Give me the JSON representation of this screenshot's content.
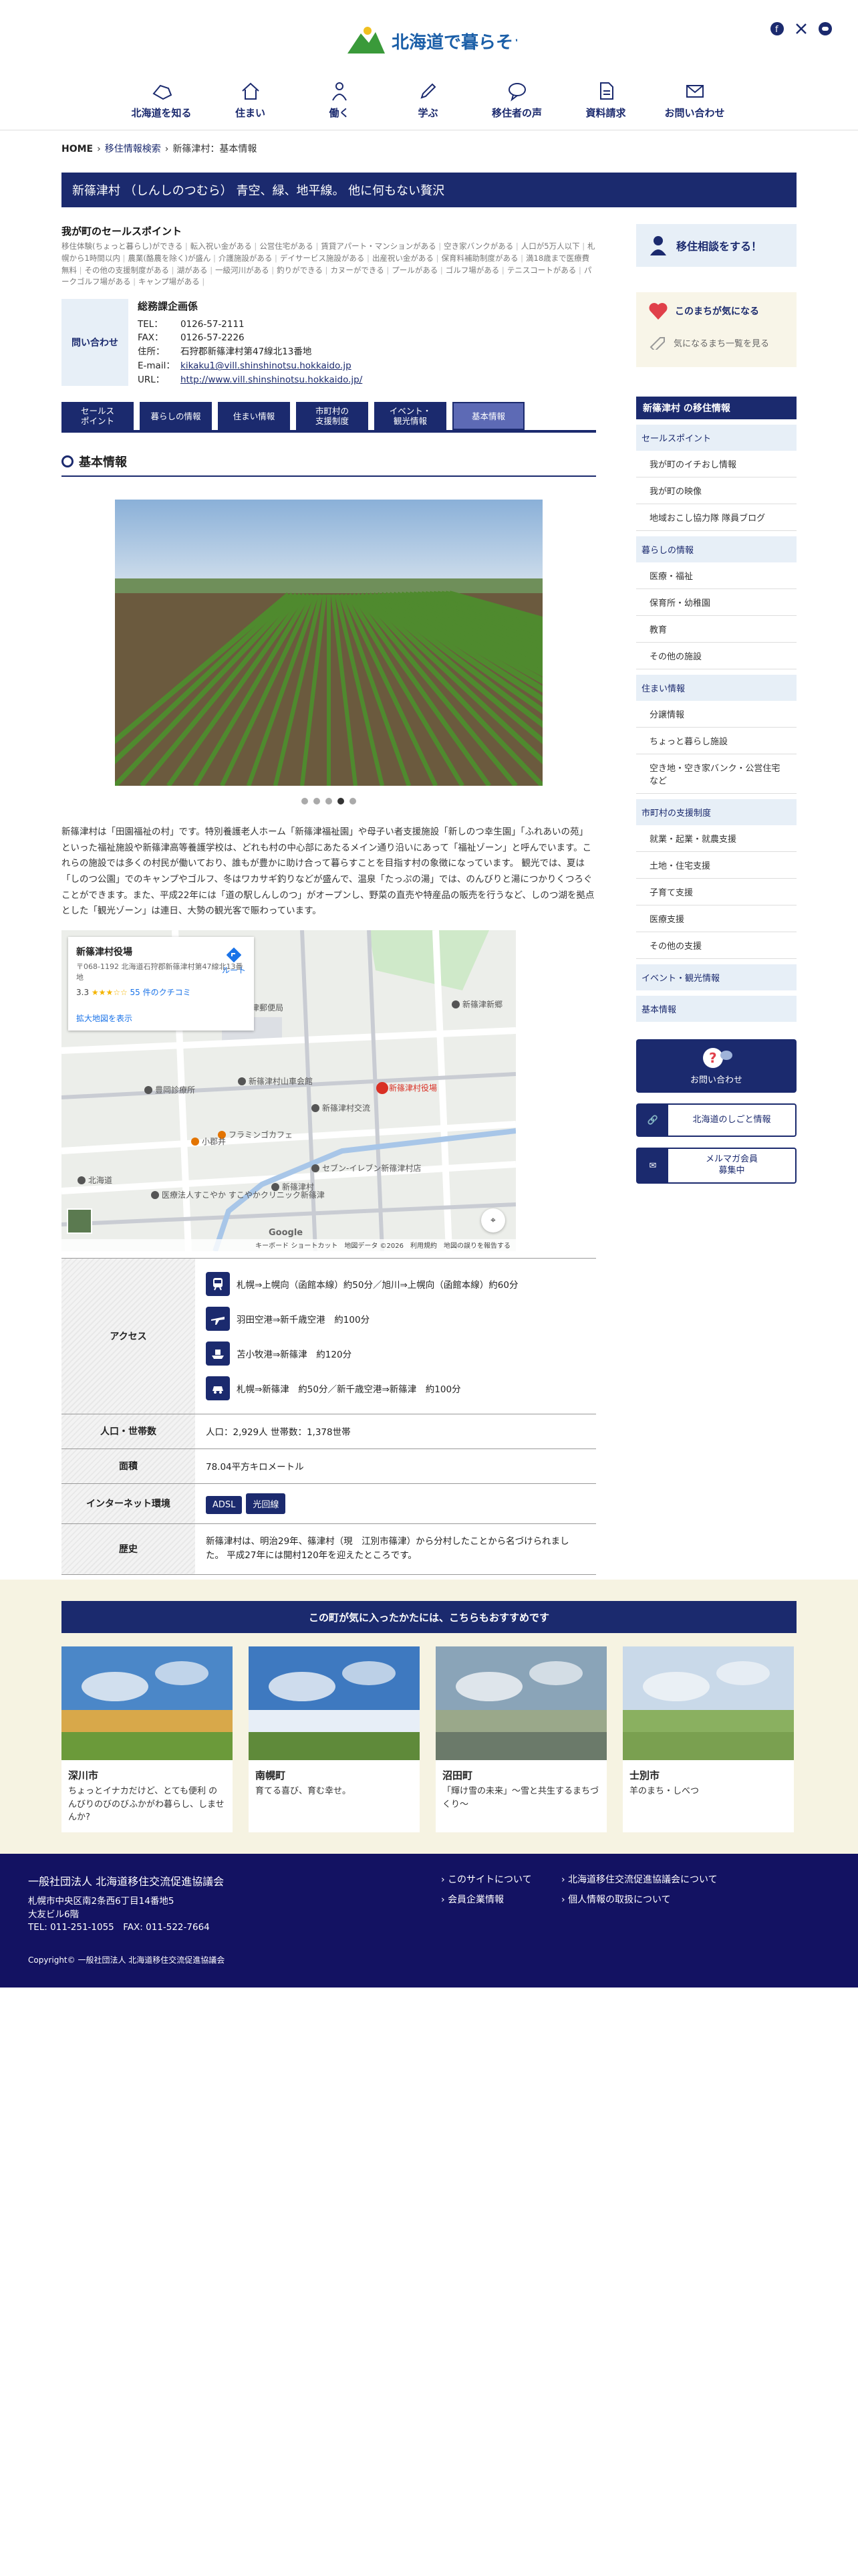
{
  "header": {
    "logo_text": "北海道で暮らそう!",
    "nav": [
      {
        "label": "北海道を知る",
        "icon": "hokkaido-icon"
      },
      {
        "label": "住まい",
        "icon": "house-icon"
      },
      {
        "label": "働く",
        "icon": "worker-icon"
      },
      {
        "label": "学ぶ",
        "icon": "pencil-icon"
      },
      {
        "label": "移住者の声",
        "icon": "speech-icon"
      },
      {
        "label": "資料請求",
        "icon": "document-icon"
      },
      {
        "label": "お問い合わせ",
        "icon": "mail-icon"
      }
    ],
    "sns": [
      "facebook-icon",
      "x-icon",
      "line-icon"
    ]
  },
  "breadcrumb": {
    "home": "HOME",
    "search": "移住情報検索",
    "current": "新篠津村：基本情報"
  },
  "title": "新篠津村 （しんしのつむら） 青空、緑、地平線。 他に何もない贅沢",
  "selling": {
    "title": "我が町のセールスポイント",
    "tags": [
      "移住体験(ちょっと暮らし)ができる",
      "転入祝い金がある",
      "公営住宅がある",
      "賃貸アパート・マンションがある",
      "空き家バンクがある",
      "人口が5万人以下",
      "札幌から1時間以内",
      "農業(酪農を除く)が盛ん",
      "介護施設がある",
      "デイサービス施設がある",
      "出産祝い金がある",
      "保育料補助制度がある",
      "満18歳まで医療費無料",
      "その他の支援制度がある",
      "湖がある",
      "一級河川がある",
      "釣りができる",
      "カヌーができる",
      "プールがある",
      "ゴルフ場がある",
      "テニスコートがある",
      "パークゴルフ場がある",
      "キャンプ場がある"
    ]
  },
  "contact": {
    "label": "問い合わせ",
    "dept": "総務課企画係",
    "rows": [
      {
        "k": "TEL：",
        "v": "0126-57-2111"
      },
      {
        "k": "FAX：",
        "v": "0126-57-2226"
      },
      {
        "k": "住所：",
        "v": "石狩郡新篠津村第47線北13番地"
      },
      {
        "k": "E-mail：",
        "v": "kikaku1@vill.shinshinotsu.hokkaido.jp",
        "link": true
      },
      {
        "k": "URL：",
        "v": "http://www.vill.shinshinotsu.hokkaido.jp/",
        "link": true
      }
    ]
  },
  "tabs": [
    "セールス\nポイント",
    "暮らしの情報",
    "住まい情報",
    "市町村の\n支援制度",
    "イベント・\n観光情報",
    "基本情報"
  ],
  "section_title": "基本情報",
  "slider": {
    "count": 5,
    "active": 3
  },
  "description": "新篠津村は「田園福祉の村」です。特別養護老人ホーム「新篠津福祉園」や母子い者支援施設「新しのつ幸生園」「ふれあいの苑」といった福祉施設や新篠津高等養護学校は、どれも村の中心部にあたるメイン通り沿いにあって「福祉ゾーン」と呼んでいます。これらの施設では多くの村民が働いており、誰もが豊かに助け合って暮らすことを目指す村の象徴になっています。 観光では、夏は「しのつ公園」でのキャンプやゴルフ、冬はワカサギ釣りなどが盛んで、温泉「たっぷの湯」では、のんびりと湯につかりくつろぐことができます。また、平成22年には「道の駅しんしのつ」がオープンし、野菜の直売や特産品の販売を行うなど、しのつ湖を拠点とした「観光ゾーン」は連日、大勢の観光客で賑わっています。",
  "map": {
    "place": "新篠津村役場",
    "address": "〒068-1192 北海道石狩郡新篠津村第47線北13番地",
    "rating": "3.3",
    "stars": "★★★☆☆",
    "reviews": "55 件のクチコミ",
    "large_map": "拡大地図を表示",
    "route": "ルート",
    "labels": [
      "新篠津村役場",
      "新篠津村山車会館",
      "フラミンゴカフェ",
      "セブン-イレブン新篠津村店",
      "新篠津村交流",
      "新篠津郵便局",
      "小郡井",
      "医療法人すこやか すこやかクリニック新篠津",
      "北海道",
      "新篠津村",
      "豊岡診療所",
      "新篠津新郷"
    ],
    "footer": [
      "キーボード ショートカット",
      "地図データ ©2026",
      "利用規約",
      "地図の誤りを報告する"
    ],
    "google": "Google"
  },
  "info": {
    "access_label": "アクセス",
    "access": [
      {
        "icon": "train-icon",
        "text": "札幌⇒上幌向（函館本線）約50分／旭川⇒上幌向（函館本線）約60分"
      },
      {
        "icon": "plane-icon",
        "text": "羽田空港⇒新千歳空港　約100分"
      },
      {
        "icon": "ship-icon",
        "text": "苫小牧港⇒新篠津　約120分"
      },
      {
        "icon": "car-icon",
        "text": "札幌⇒新篠津　約50分／新千歳空港⇒新篠津　約100分"
      }
    ],
    "population_label": "人口・世帯数",
    "population": "人口：2,929人 世帯数：1,378世帯",
    "area_label": "面積",
    "area": "78.04平方キロメートル",
    "internet_label": "インターネット環境",
    "internet": [
      "ADSL",
      "光回線"
    ],
    "history_label": "歴史",
    "history": "新篠津村は、明治29年、篠津村（現　江別市篠津）から分村したことから名づけられました。 平成27年には開村120年を迎えたところです。"
  },
  "sidebar": {
    "consult": "移住相談をする！",
    "fav": "このまちが気になる",
    "fav_list": "気になるまち一覧を見る",
    "head": "新篠津村 の移住情報",
    "nav": [
      {
        "cat": "セールスポイント",
        "subs": [
          "我が町のイチおし情報",
          "我が町の映像",
          "地域おこし協力隊 隊員ブログ"
        ]
      },
      {
        "cat": "暮らしの情報",
        "subs": [
          "医療・福祉",
          "保育所・幼稚園",
          "教育",
          "その他の施設"
        ]
      },
      {
        "cat": "住まい情報",
        "subs": [
          "分譲情報",
          "ちょっと暮らし施設",
          "空き地・空き家バンク・公営住宅など"
        ]
      },
      {
        "cat": "市町村の支援制度",
        "subs": [
          "就業・起業・就農支援",
          "土地・住宅支援",
          "子育て支援",
          "医療支援",
          "その他の支援"
        ]
      },
      {
        "cat": "イベント・観光情報",
        "subs": []
      },
      {
        "cat": "基本情報",
        "subs": []
      }
    ],
    "contact": "お問い合わせ",
    "jobs": "北海道のしごと情報",
    "mail": "メルマガ会員\n募集中"
  },
  "recommend": {
    "head": "この町が気に入ったかたには、こちらもおすすめです",
    "cards": [
      {
        "name": "深川市",
        "text": "ちょっとイナカだけど、とても便利 のんびりのびのびふかがわ暮らし、しませんか?"
      },
      {
        "name": "南幌町",
        "text": "育てる喜び、育む幸せ。"
      },
      {
        "name": "沼田町",
        "text": "「輝け雪の未来」～雪と共生するまちづくり～"
      },
      {
        "name": "士別市",
        "text": "羊のまち・しべつ"
      }
    ]
  },
  "footer": {
    "org": "一般社団法人 北海道移住交流促進協議会",
    "address": "札幌市中央区南2条西6丁目14番地5\n大友ビル6階\nTEL: 011-251-1055　FAX: 011-522-7664",
    "links": [
      "このサイトについて",
      "北海道移住交流促進協議会について",
      "会員企業情報",
      "個人情報の取扱について"
    ],
    "copyright": "Copyright© 一般社団法人 北海道移住交流促進協議会"
  },
  "colors": {
    "primary": "#1b2a6e",
    "light": "#e7eff7",
    "cream": "#f6f3e2",
    "footer": "#131262"
  }
}
